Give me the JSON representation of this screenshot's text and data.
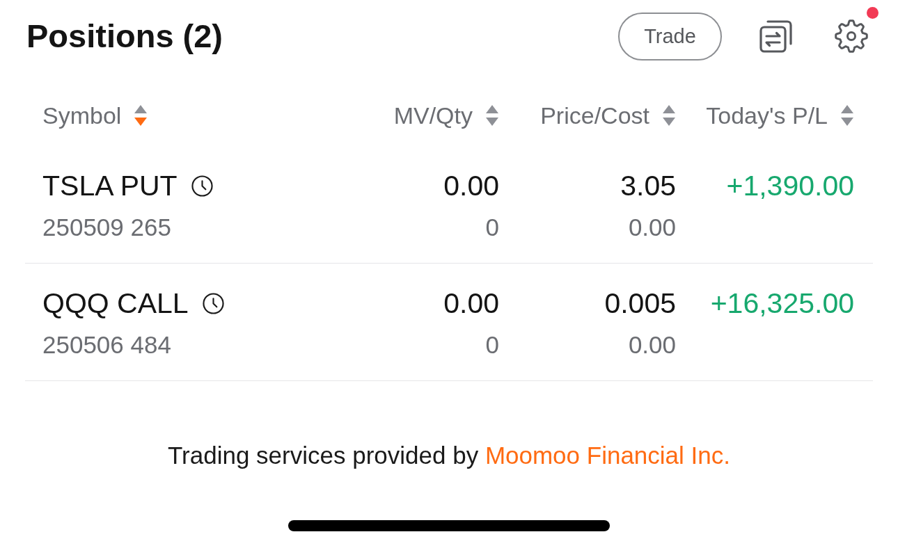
{
  "header": {
    "title": "Positions (2)",
    "trade_button": "Trade",
    "settings": {
      "badge": true
    }
  },
  "table": {
    "columns": [
      {
        "label": "Symbol",
        "sorted_descending": true
      },
      {
        "label": "MV/Qty",
        "sorted_descending": false
      },
      {
        "label": "Price/Cost",
        "sorted_descending": false
      },
      {
        "label": "Today's P/L",
        "sorted_descending": false
      }
    ],
    "rows": [
      {
        "symbol": "TSLA PUT",
        "contract": "250509 265",
        "market_value": "0.00",
        "quantity": "0",
        "price": "3.05",
        "cost": "0.00",
        "todays_pl": "+1,390.00",
        "gain": true
      },
      {
        "symbol": "QQQ CALL",
        "contract": "250506 484",
        "market_value": "0.00",
        "quantity": "0",
        "price": "0.005",
        "cost": "0.00",
        "todays_pl": "+16,325.00",
        "gain": true
      }
    ]
  },
  "footer": {
    "text": "Trading services provided by",
    "link": "Moomoo Financial Inc."
  }
}
